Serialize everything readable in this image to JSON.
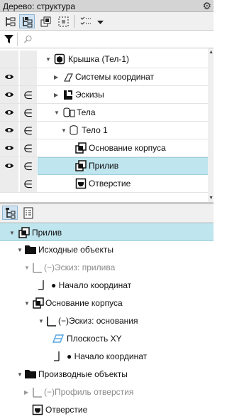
{
  "window": {
    "title": "Дерево: структура",
    "settings_icon": "gear-icon"
  },
  "toolbar": {
    "buttons": [
      "tree-view-icon",
      "structure-view-icon",
      "copy-icon",
      "select-frame-icon",
      "list-checks-icon",
      "dropdown-arrow-icon"
    ]
  },
  "filter": {
    "filter_icon": "funnel-icon",
    "search_icon": "search-icon",
    "search_value": ""
  },
  "upper_tree": {
    "rows": [
      {
        "label": "Крышка (Тел-1)",
        "icon": "part-icon",
        "visible": false,
        "in_model": false,
        "expander": "expanded",
        "selected": false
      },
      {
        "label": "Системы координат",
        "icon": "coordinate-system-icon",
        "visible": true,
        "in_model": false,
        "expander": "collapsed",
        "selected": false
      },
      {
        "label": "Эскизы",
        "icon": "sketch-icon",
        "visible": true,
        "in_model": true,
        "expander": "collapsed",
        "selected": false
      },
      {
        "label": "Тела",
        "icon": "bodies-icon",
        "visible": true,
        "in_model": true,
        "expander": "expanded",
        "selected": false
      },
      {
        "label": "Тело 1",
        "icon": "body-icon",
        "visible": true,
        "in_model": true,
        "expander": "expanded",
        "selected": false
      },
      {
        "label": "Основание корпуса",
        "icon": "extrusion-icon",
        "visible": true,
        "in_model": true,
        "expander": "none",
        "selected": false
      },
      {
        "label": "Прилив",
        "icon": "extrusion-icon",
        "visible": true,
        "in_model": true,
        "expander": "none",
        "selected": true
      },
      {
        "label": "Отверстие",
        "icon": "hole-icon",
        "visible": false,
        "in_model": true,
        "expander": "none",
        "selected": false
      }
    ]
  },
  "panel_tabs": [
    "tree-tab-icon",
    "properties-tab-icon"
  ],
  "lower_tree": {
    "rows": [
      {
        "label": "Прилив",
        "icon": "extrusion-icon",
        "expander": "expanded",
        "selected": true,
        "grey": false
      },
      {
        "label": "Исходные объекты",
        "icon": "folder-icon",
        "expander": "expanded",
        "selected": false,
        "grey": false
      },
      {
        "label": "(−)Эскиз: прилива",
        "icon": "sketch-icon",
        "expander": "expanded",
        "selected": false,
        "grey": true
      },
      {
        "label": "● Начало координат",
        "icon": "origin-icon",
        "expander": "none",
        "selected": false,
        "grey": false
      },
      {
        "label": "Основание корпуса",
        "icon": "extrusion-icon",
        "expander": "expanded",
        "selected": false,
        "grey": false
      },
      {
        "label": "(−)Эскиз: основания",
        "icon": "sketch-icon",
        "expander": "expanded",
        "selected": false,
        "grey": false
      },
      {
        "label": "Плоскость XY",
        "icon": "plane-icon",
        "expander": "none",
        "selected": false,
        "grey": false
      },
      {
        "label": "● Начало координат",
        "icon": "origin-icon",
        "expander": "none",
        "selected": false,
        "grey": false
      },
      {
        "label": "Производные объекты",
        "icon": "folder-icon",
        "expander": "expanded",
        "selected": false,
        "grey": false
      },
      {
        "label": "(−)Профиль отверстия",
        "icon": "sketch-icon",
        "expander": "collapsed",
        "selected": false,
        "grey": true
      },
      {
        "label": "Отверстие",
        "icon": "hole-icon",
        "expander": "none",
        "selected": false,
        "grey": false
      }
    ]
  },
  "colors": {
    "selection": "#bfe5ee",
    "selection_border": "#9fd0dc",
    "gutter": "#ececec",
    "titlebar": "#d4d4d4",
    "plane": "#5aa7e0"
  }
}
